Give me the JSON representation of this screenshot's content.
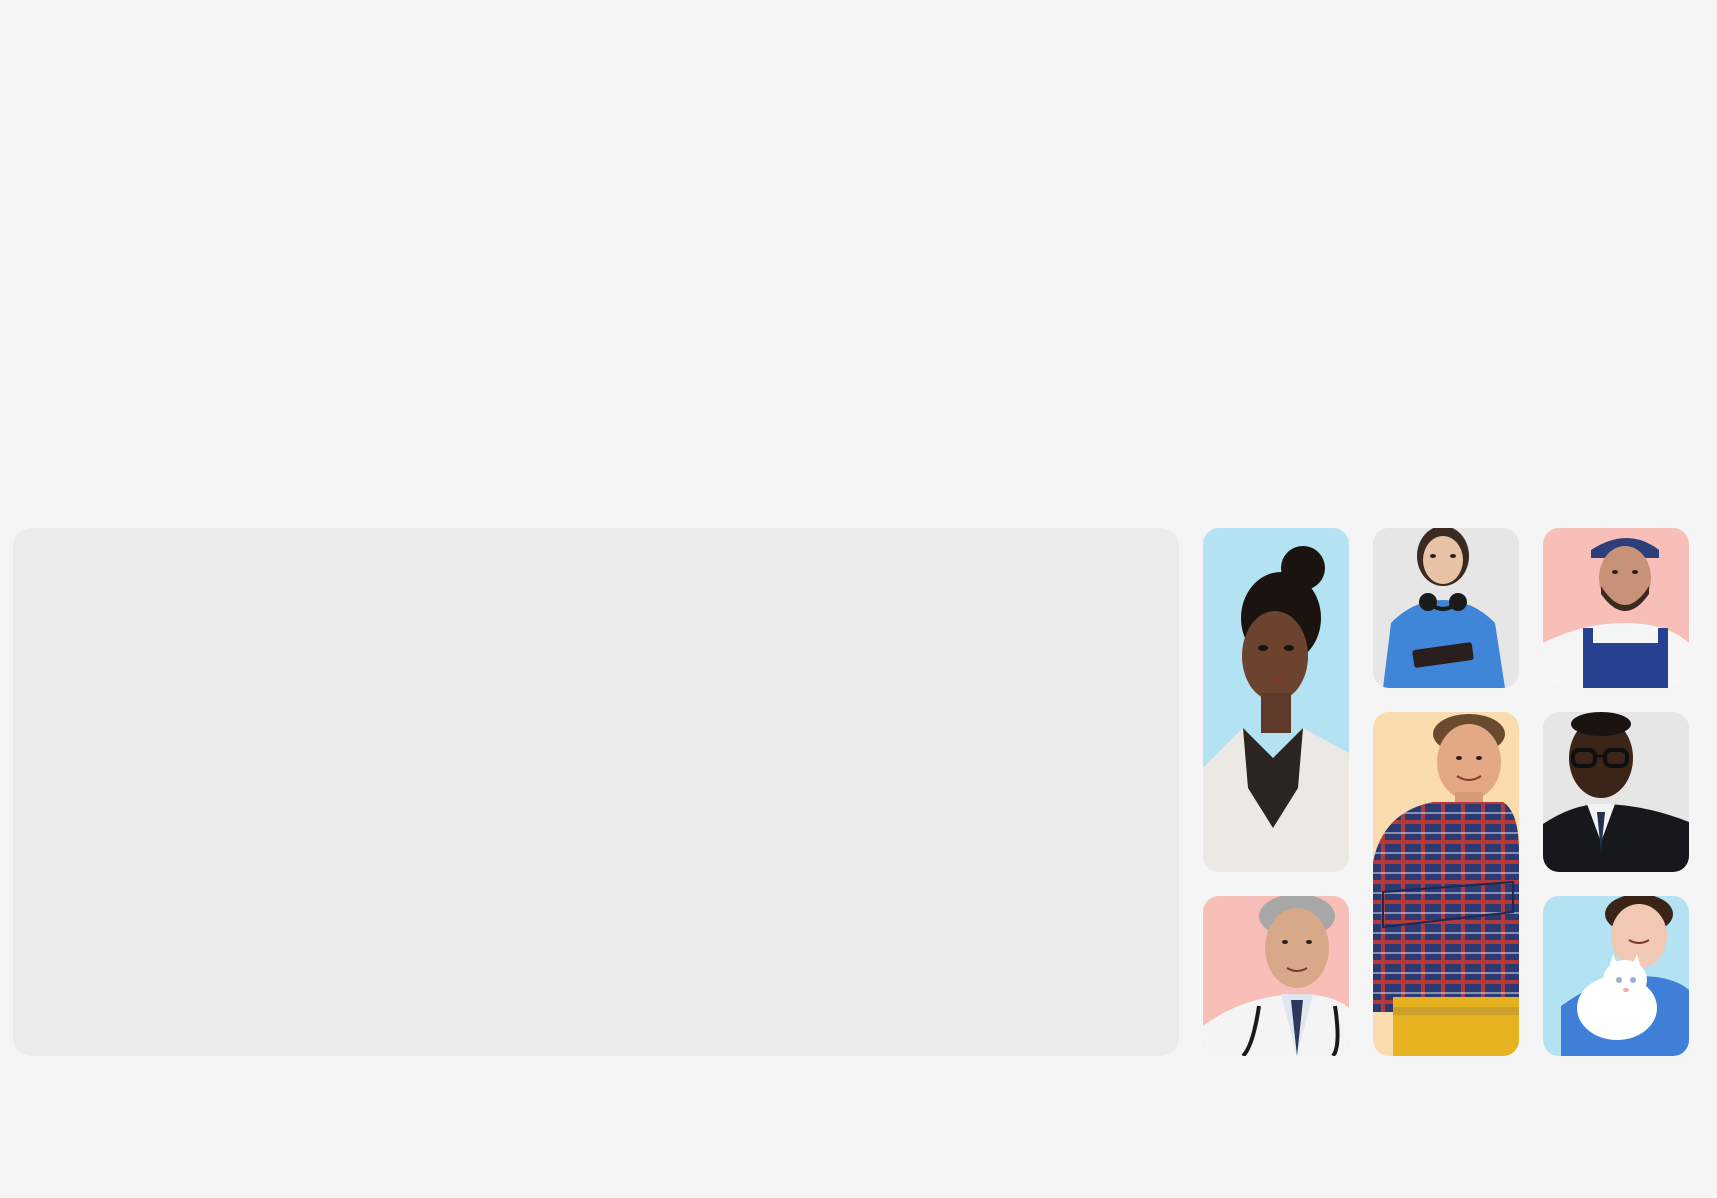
{
  "people_grid": {
    "tiles": [
      {
        "name": "woman-blazer",
        "bg": "#b3e3f2"
      },
      {
        "name": "woman-headphones-tablet",
        "bg": "#e6e6e6"
      },
      {
        "name": "man-overalls-cap",
        "bg": "#f7bfb7"
      },
      {
        "name": "man-plaid-toolbelt",
        "bg": "#fbdcae"
      },
      {
        "name": "man-glasses-suit",
        "bg": "#e6e6e6"
      },
      {
        "name": "doctor-stethoscope",
        "bg": "#f7bfb7"
      },
      {
        "name": "woman-white-cat",
        "bg": "#b3e3f2"
      }
    ]
  }
}
